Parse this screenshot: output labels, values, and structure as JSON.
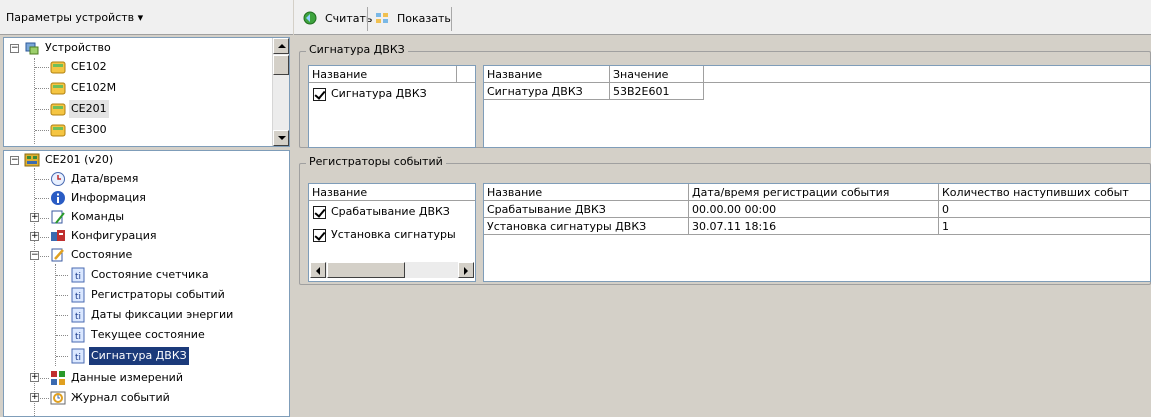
{
  "left_toolbar": {
    "title": "Параметры устройств ▾"
  },
  "right_toolbar": {
    "read_label": "Считать",
    "show_label": "Показать"
  },
  "device_tree": {
    "root": "Устройство",
    "items": [
      "CE102",
      "CE102M",
      "CE201",
      "CE300"
    ],
    "selected": "CE201"
  },
  "param_tree": {
    "root": "CE201 (v20)",
    "items": [
      {
        "label": "Дата/время",
        "icon": "clock-icon"
      },
      {
        "label": "Информация",
        "icon": "info-icon"
      },
      {
        "label": "Команды",
        "icon": "commands-icon",
        "expandable": true
      },
      {
        "label": "Конфигурация",
        "icon": "config-icon",
        "expandable": true
      },
      {
        "label": "Состояние",
        "icon": "state-icon",
        "expanded": true
      },
      {
        "label": "Состояние счетчика",
        "icon": "doc-icon"
      },
      {
        "label": "Регистраторы событий",
        "icon": "doc-icon"
      },
      {
        "label": "Даты фиксации энергии",
        "icon": "doc-icon"
      },
      {
        "label": "Текущее состояние",
        "icon": "doc-icon"
      },
      {
        "label": "Сигнатура ДВКЗ",
        "icon": "doc-icon",
        "selected": true
      },
      {
        "label": "Данные измерений",
        "icon": "measure-icon",
        "expandable": true
      },
      {
        "label": "Журнал событий",
        "icon": "journal-icon",
        "expandable": true
      }
    ]
  },
  "group1": {
    "title": "Сигнатура ДВКЗ",
    "left_header": "Название",
    "left_rows": [
      "Сигнатура ДВКЗ"
    ],
    "right_headers": [
      "Название",
      "Значение"
    ],
    "right_rows": [
      [
        "Сигнатура ДВКЗ",
        "53B2E601"
      ]
    ]
  },
  "group2": {
    "title": "Регистраторы событий",
    "left_header": "Название",
    "left_rows": [
      "Срабатывание ДВКЗ",
      "Установка сигнатуры"
    ],
    "right_headers": [
      "Название",
      "Дата/время регистрации события",
      "Количество наступивших событ"
    ],
    "right_rows": [
      [
        "Срабатывание ДВКЗ",
        "00.00.00 00:00",
        "0"
      ],
      [
        "Установка сигнатуры ДВКЗ",
        "30.07.11 18:16",
        "1"
      ]
    ]
  },
  "colors": {
    "selection": "#1b3a7a",
    "panel_bg": "#d4d0c8",
    "border": "#7f9db9"
  }
}
